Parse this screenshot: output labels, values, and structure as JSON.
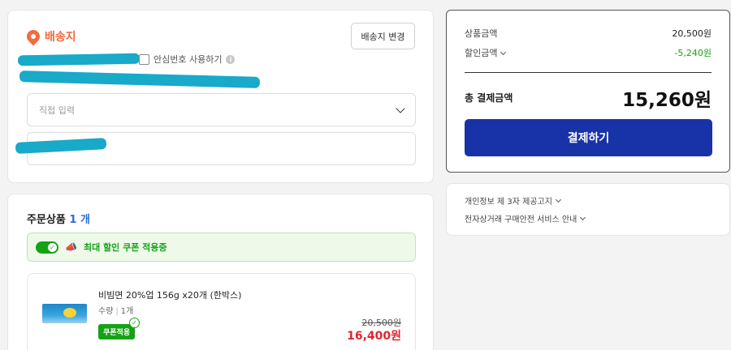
{
  "shipping": {
    "title": "배송지",
    "change_button": "배송지 변경",
    "safe_number_label": "안심번호 사용하기",
    "info_glyph": "i",
    "memo_placeholder": "직접 입력",
    "accent_color": "#f26a3d"
  },
  "order": {
    "title": "주문상품",
    "count": "1 개",
    "coupon_banner": "최대 할인 쿠폰 적용중",
    "coupon_toggle_on": true,
    "item": {
      "name": "비빔면 20%업 156g x20개 (한박스)",
      "qty_label": "수량",
      "qty_value": "1개",
      "coupon_badge": "쿠폰적용",
      "original_price": "20,500원",
      "sale_price": "16,400원"
    }
  },
  "payment": {
    "product_amount_label": "상품금액",
    "product_amount": "20,500원",
    "discount_label": "할인금액",
    "discount_amount": "-5,240원",
    "total_label": "총 결제금액",
    "total_amount": "15,260원",
    "pay_button": "결제하기",
    "button_color": "#1833a8",
    "discount_color": "#16a216"
  },
  "notices": {
    "privacy": "개인정보 제 3자 제공고지",
    "ecommerce": "전자상거래 구매안전 서비스 안내"
  }
}
